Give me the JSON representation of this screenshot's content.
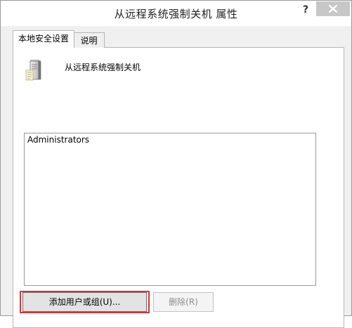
{
  "window": {
    "title": "从远程系统强制关机 属性",
    "help_label": "?"
  },
  "tabs": [
    {
      "label": "本地安全设置",
      "active": true
    },
    {
      "label": "说明",
      "active": false
    }
  ],
  "policy": {
    "icon": "server-icon",
    "name": "从远程系统强制关机"
  },
  "members": {
    "items": [
      "Administrators"
    ]
  },
  "buttons": {
    "add_label": "添加用户或组(U)...",
    "remove_label": "删除(R)"
  },
  "colors": {
    "highlight": "#d9333a",
    "close_button_bg": "#c7c7c7",
    "dialog_bg": "#f0f0f0"
  }
}
